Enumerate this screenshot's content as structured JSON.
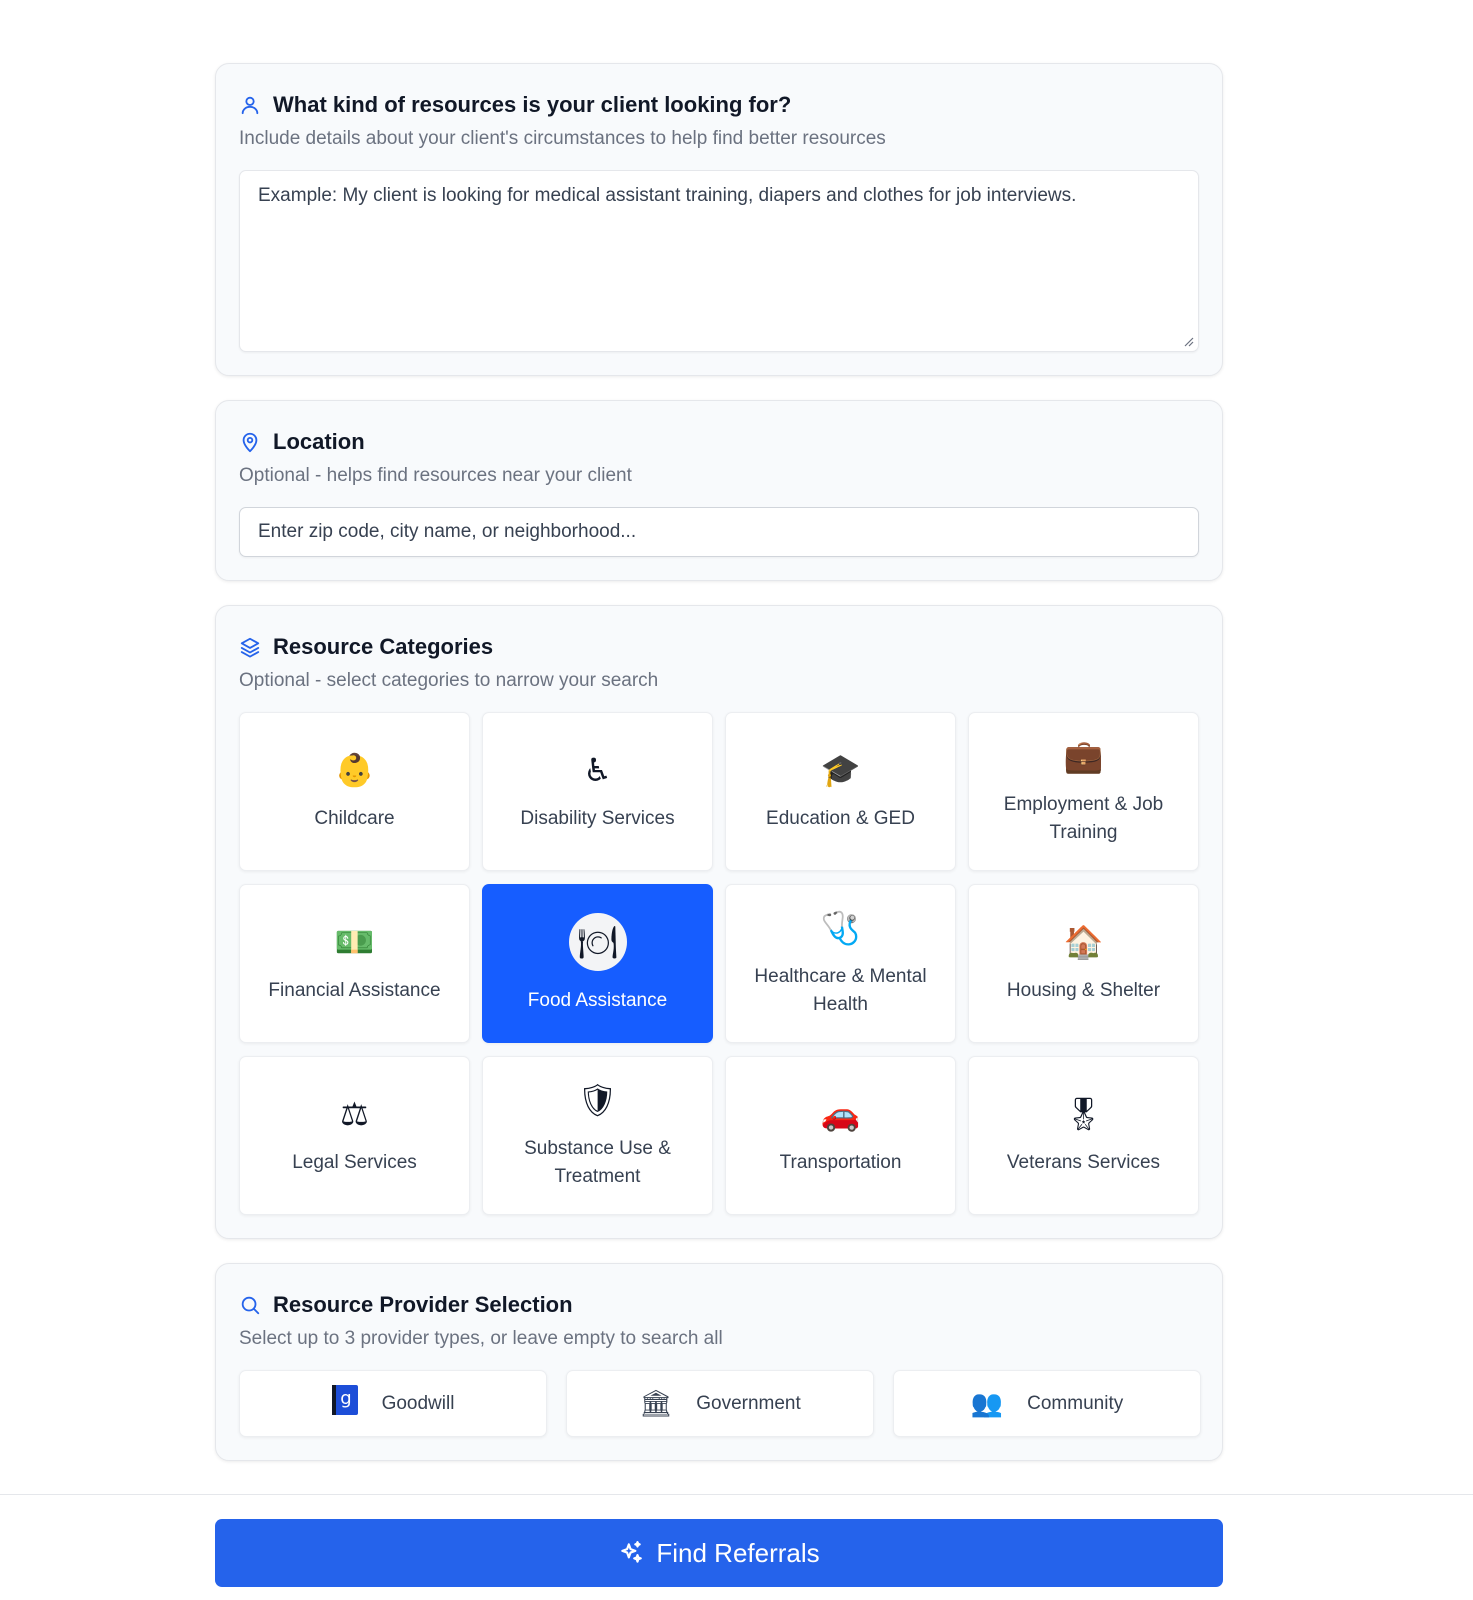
{
  "query_card": {
    "title": "What kind of resources is your client looking for?",
    "subtitle": "Include details about your client's circumstances to help find better resources",
    "placeholder": "Example: My client is looking for medical assistant training, diapers and clothes for job interviews."
  },
  "location_card": {
    "title": "Location",
    "subtitle": "Optional - helps find resources near your client",
    "placeholder": "Enter zip code, city name, or neighborhood..."
  },
  "categories_card": {
    "title": "Resource Categories",
    "subtitle": "Optional - select categories to narrow your search",
    "items": [
      {
        "label": "Childcare",
        "icon": "👶",
        "selected": false
      },
      {
        "label": "Disability Services",
        "icon": "♿",
        "selected": false
      },
      {
        "label": "Education & GED",
        "icon": "🎓",
        "selected": false
      },
      {
        "label": "Employment & Job Training",
        "icon": "💼",
        "selected": false
      },
      {
        "label": "Financial Assistance",
        "icon": "💵",
        "selected": false
      },
      {
        "label": "Food Assistance",
        "icon": "🍽",
        "selected": true
      },
      {
        "label": "Healthcare & Mental Health",
        "icon": "🩺",
        "selected": false
      },
      {
        "label": "Housing & Shelter",
        "icon": "🏠",
        "selected": false
      },
      {
        "label": "Legal Services",
        "icon": "⚖",
        "selected": false
      },
      {
        "label": "Substance Use & Treatment",
        "icon": "🛡",
        "selected": false
      },
      {
        "label": "Transportation",
        "icon": "🚗",
        "selected": false
      },
      {
        "label": "Veterans Services",
        "icon": "🎖",
        "selected": false
      }
    ]
  },
  "providers_card": {
    "title": "Resource Provider Selection",
    "subtitle": "Select up to 3 provider types, or leave empty to search all",
    "items": [
      {
        "label": "Goodwill",
        "icon": "g"
      },
      {
        "label": "Government",
        "icon": "🏛"
      },
      {
        "label": "Community",
        "icon": "👥"
      }
    ]
  },
  "footer": {
    "button_label": "Find Referrals"
  },
  "colors": {
    "accent": "#2563eb",
    "selected_tile": "#165dff",
    "muted_text": "#6b7280"
  }
}
